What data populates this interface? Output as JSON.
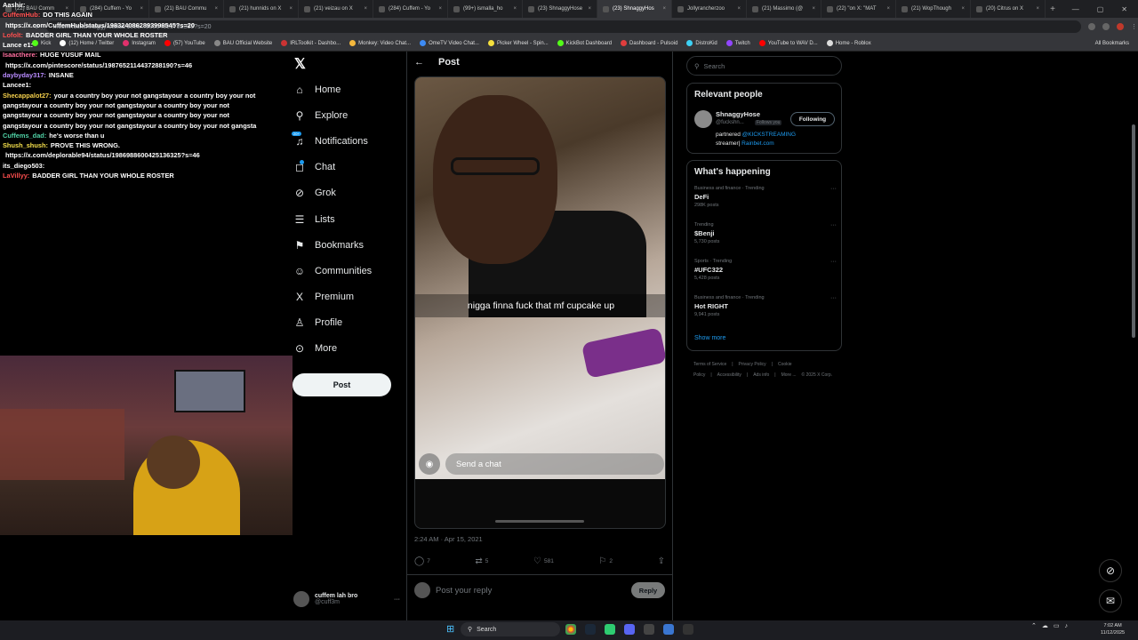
{
  "browser": {
    "tabs": [
      {
        "label": "(22) BAU Comm",
        "active": false
      },
      {
        "label": "(284) Cuffem - Yo",
        "active": false
      },
      {
        "label": "(21) BAU Commu",
        "active": false
      },
      {
        "label": "(21) hunnids on X",
        "active": false
      },
      {
        "label": "(21) veizau on X",
        "active": false
      },
      {
        "label": "(284) Cuffem - Yo",
        "active": false
      },
      {
        "label": "(99+) ismalla_ho",
        "active": false
      },
      {
        "label": "(23) ShnaggyHose",
        "active": false
      },
      {
        "label": "(23) ShnaggyHos",
        "active": true
      },
      {
        "label": "Jollyrancherzoo",
        "active": false
      },
      {
        "label": "(21) Massimo (@",
        "active": false
      },
      {
        "label": "(22) \"on X: \"MAT",
        "active": false
      },
      {
        "label": "(21) WopThough",
        "active": false
      },
      {
        "label": "(20) Citrus on X",
        "active": false
      }
    ],
    "url": "x.com/fuckshnaggy/status/1986...90054651792389?s=20",
    "bookmarks": [
      {
        "label": "Kick",
        "color": "#53fc18"
      },
      {
        "label": "(12) Home / Twitter",
        "color": "#ffffff"
      },
      {
        "label": "Instagram",
        "color": "#e1306c"
      },
      {
        "label": "(57) YouTube",
        "color": "#ff0000"
      },
      {
        "label": "BAU Official Website",
        "color": "#888888"
      },
      {
        "label": "IRLToolkit - Dashbo...",
        "color": "#cc3333"
      },
      {
        "label": "Monkey: Video Chat...",
        "color": "#f5b83d"
      },
      {
        "label": "OmeTV Video Chat...",
        "color": "#3d8bf5"
      },
      {
        "label": "Picker Wheel - Spin...",
        "color": "#f5e03d"
      },
      {
        "label": "KickBot Dashboard",
        "color": "#53fc18"
      },
      {
        "label": "Dashboard - Pulsoid",
        "color": "#e03d3d"
      },
      {
        "label": "DistroKid",
        "color": "#3dd1f5"
      },
      {
        "label": "Twitch",
        "color": "#9146ff"
      },
      {
        "label": "YouTube to WAV D...",
        "color": "#ff0000"
      },
      {
        "label": "Home - Roblox",
        "color": "#dddddd"
      }
    ],
    "all_bookmarks": "All Bookmarks"
  },
  "chat": [
    {
      "user": "Aashir:",
      "color": "#ffffff",
      "text": ""
    },
    {
      "user": "CuffemHub:",
      "color": "#ff4f4f",
      "text": "DO THIS AGAIN"
    },
    {
      "user": "",
      "color": "#ffffff",
      "text": "https://x.com/CuffemHub/status/1983240862893998545?s=20"
    },
    {
      "user": "Lofolt:",
      "color": "#ff4f4f",
      "text": "BADDER GIRL THAN YOUR WHOLE ROSTER"
    },
    {
      "user": "Lance e1:",
      "color": "#ffffff",
      "text": ""
    },
    {
      "user": "Isaacthere:",
      "color": "#ff6f9f",
      "text": "HUGE YUSUF MAIL"
    },
    {
      "user": "",
      "color": "#ffffff",
      "text": "https://x.com/pintescore/status/1987652114437288190?s=46"
    },
    {
      "user": "daybyday317:",
      "color": "#b98bff",
      "text": "INSANE"
    },
    {
      "user": "Lancee1:",
      "color": "#ffffff",
      "text": ""
    },
    {
      "user": "Shecappalot27:",
      "color": "#f5d04c",
      "text": "your a country boy your not gangstayour a country boy your not gangstayour a country boy your not gangstayour a country boy your not gangstayour a country boy your not gangstayour a country boy your not gangstayour a country boy your not gangstayour a country boy your not gangsta"
    },
    {
      "user": "Cuffems_dad:",
      "color": "#4fd1a5",
      "text": "he's worse than u"
    },
    {
      "user": "Shush_shush:",
      "color": "#f5e04c",
      "text": "PROVE THIS WRONG."
    },
    {
      "user": "",
      "color": "#ffffff",
      "text": "https://x.com/deplorable94/status/1986988600425136325?s=46"
    },
    {
      "user": "its_diego503:",
      "color": "#ffffff",
      "text": ""
    },
    {
      "user": "LaVillyy:",
      "color": "#ff4f4f",
      "text": "BADDER GIRL THAN YOUR WHOLE ROSTER"
    }
  ],
  "x_nav": {
    "items": [
      {
        "label": "Home",
        "icon": "home-icon",
        "glyph": "⌂"
      },
      {
        "label": "Explore",
        "icon": "search-icon",
        "glyph": "⚲"
      },
      {
        "label": "Notifications",
        "icon": "bell-icon",
        "glyph": "♫",
        "badge": "20+"
      },
      {
        "label": "Chat",
        "icon": "chat-icon",
        "glyph": "◻"
      },
      {
        "label": "Grok",
        "icon": "grok-icon",
        "glyph": "⊘"
      },
      {
        "label": "Lists",
        "icon": "list-icon",
        "glyph": "☰"
      },
      {
        "label": "Bookmarks",
        "icon": "bookmark-icon",
        "glyph": "⚑"
      },
      {
        "label": "Communities",
        "icon": "communities-icon",
        "glyph": "☺"
      },
      {
        "label": "Premium",
        "icon": "x-premium-icon",
        "glyph": "X"
      },
      {
        "label": "Profile",
        "icon": "profile-icon",
        "glyph": "♙"
      },
      {
        "label": "More",
        "icon": "more-circle-icon",
        "glyph": "⊙"
      }
    ],
    "post_button": "Post",
    "account_name": "cuffem lah bro",
    "account_handle": "@cuff3m"
  },
  "post": {
    "header_title": "Post",
    "caption": "nigga finna fuck that mf cupcake up",
    "send_chat_placeholder": "Send a chat",
    "timestamp": "2:24 AM · Apr 15, 2021",
    "replies": "7",
    "reposts": "5",
    "likes": "581",
    "bookmarks": "2",
    "reply_placeholder": "Post your reply",
    "reply_button": "Reply"
  },
  "right": {
    "search_placeholder": "Search",
    "relevant_title": "Relevant people",
    "person_name": "ShnaggyHose",
    "person_handle": "@fuckshn...",
    "follows_you": "Follows you",
    "following_button": "Following",
    "bio_prefix": "partnered ",
    "bio_link1": "@KICKSTREAMING",
    "bio_mid": "streamer| ",
    "bio_link2": "Rainbet.com",
    "happening_title": "What's happening",
    "trends": [
      {
        "context": "Business and finance · Trending",
        "name": "DeFi",
        "count": "298K posts"
      },
      {
        "context": "Trending",
        "name": "$Benji",
        "count": "5,730 posts"
      },
      {
        "context": "Sports · Trending",
        "name": "#UFC322",
        "count": "5,428 posts"
      },
      {
        "context": "Business and finance · Trending",
        "name": "Hot RIGHT",
        "count": "9,941 posts"
      }
    ],
    "show_more": "Show more",
    "footer": [
      "Terms of Service",
      "|",
      "Privacy Policy",
      "|",
      "Cookie Policy",
      "|",
      "Accessibility",
      "|",
      "Ads info",
      "|",
      "More ...",
      "© 2025 X Corp."
    ]
  },
  "taskbar": {
    "search": "Search",
    "time": "7:02 AM",
    "date": "11/12/2025"
  }
}
